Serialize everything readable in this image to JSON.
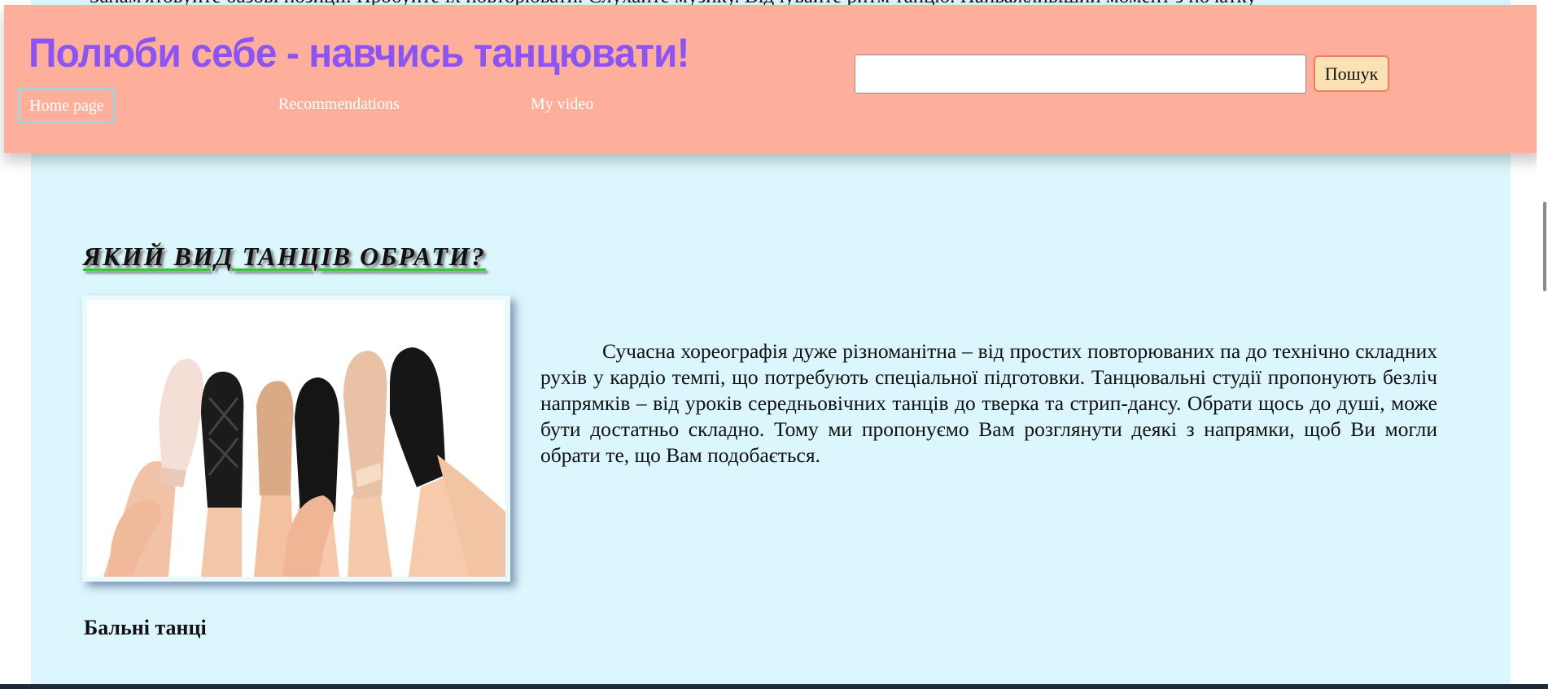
{
  "header": {
    "title": "Полюби себе - навчись танцювати!",
    "nav": {
      "home": "Home page",
      "recommendations": "Recommendations",
      "video": "My video"
    },
    "search": {
      "value": "",
      "button_label": "Пошук"
    }
  },
  "behind_header_text": "Запам'ятовуйте базові позиції. Пробуйте їх повторювати. Слухайте музику. Відчувайте ритм танцю. Найважливіший момент з початку",
  "content": {
    "section_title": "ЯКИЙ ВИД ТАНЦІВ ОБРАТИ?",
    "paragraph": "Сучасна хореографія дуже різноманітна – від простих повторюваних па до технічно складних рухів у кардіо темпі, що потребують спеціальної підготовки. Танцювальні студії пропонують безліч напрямків – від уроків середньовічних танців до тверка та стрип-дансу. Обрати щось до душі, може бути достатньо складно. Тому ми пропонуємо Вам розглянути деякі з напрямки, щоб Ви могли обрати те, що Вам подобається.",
    "subheading": "Бальні танці"
  },
  "colors": {
    "header_bg": "#fdaf9b",
    "title": "#8c55f3",
    "page_bg": "#dbf6fc",
    "search_button_bg": "#fbe1b3",
    "search_button_border": "#ef7d62",
    "heading_underline": "#3fc23d"
  }
}
